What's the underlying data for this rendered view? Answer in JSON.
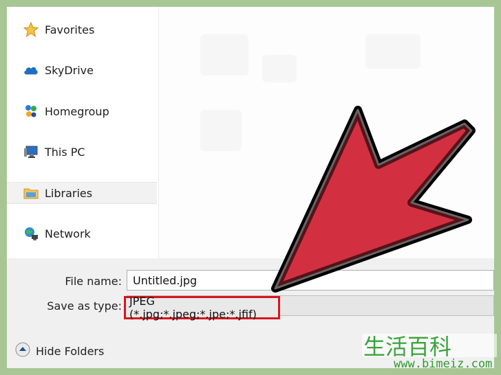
{
  "nav": {
    "items": [
      {
        "label": "Favorites",
        "icon": "star-icon"
      },
      {
        "label": "SkyDrive",
        "icon": "cloud-icon"
      },
      {
        "label": "Homegroup",
        "icon": "homegroup-icon"
      },
      {
        "label": "This PC",
        "icon": "computer-icon"
      },
      {
        "label": "Libraries",
        "icon": "folder-icon",
        "selected": true
      },
      {
        "label": "Network",
        "icon": "network-icon"
      }
    ]
  },
  "form": {
    "file_name_label": "File name:",
    "file_name_value": "Untitled.jpg",
    "save_as_type_label": "Save as type:",
    "save_as_type_value": "JPEG (*.jpg;*.jpeg;*.jpe;*.jfif)"
  },
  "footer": {
    "hide_folders_label": "Hide Folders",
    "hide_folders_icon": "chevron-up-icon"
  },
  "overlay": {
    "arrow_color": "#d23040",
    "highlight_color": "#d9141d"
  },
  "watermark": {
    "chars": "生活百科",
    "url": "www.bimeiz.com"
  }
}
